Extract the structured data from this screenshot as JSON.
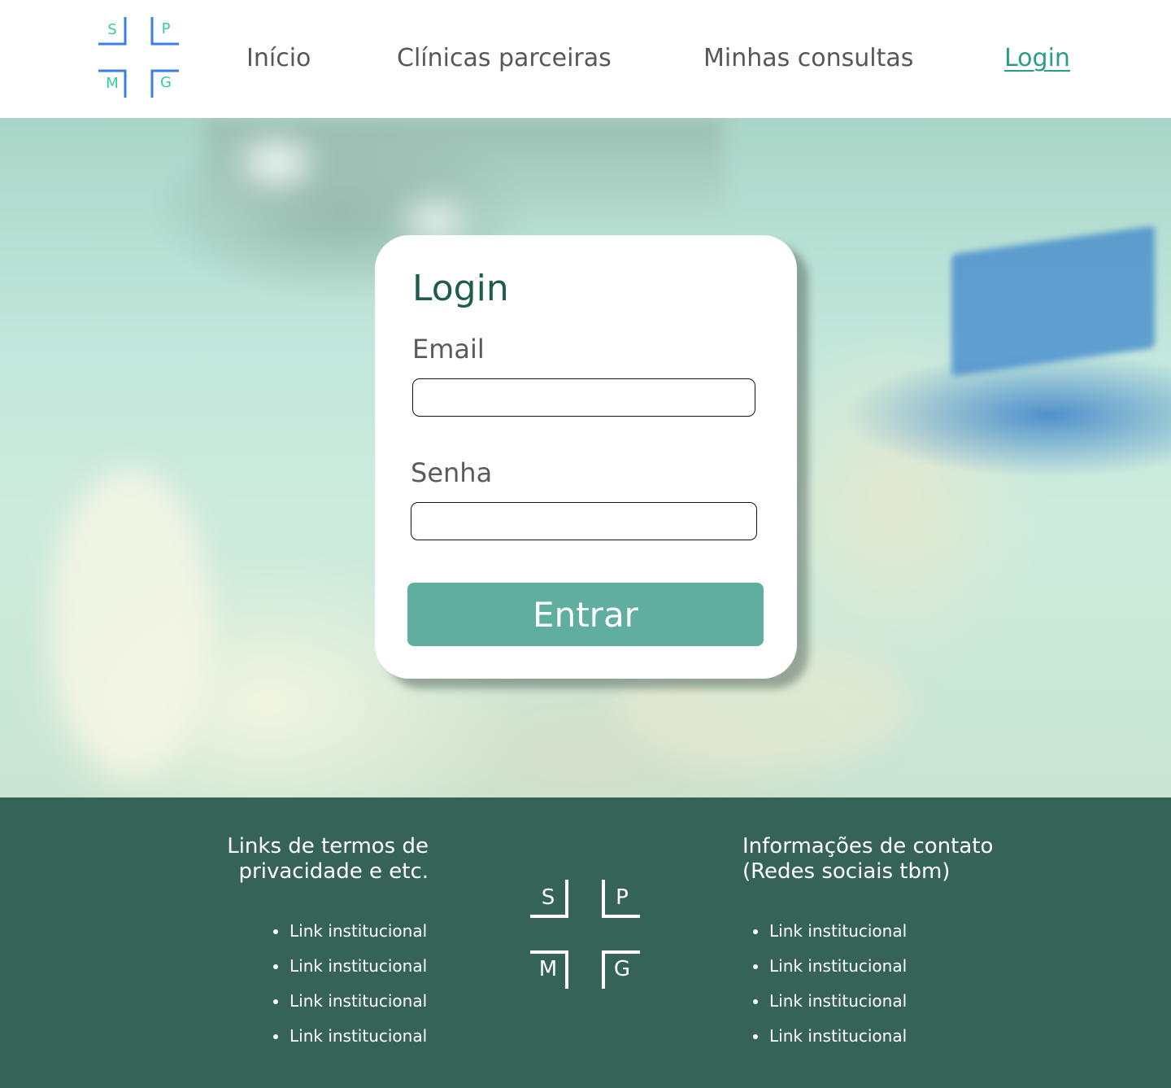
{
  "logo": {
    "letters": [
      "S",
      "P",
      "M",
      "G"
    ],
    "accent_color": "#3b7fe0",
    "letter_color": "#2fcf9f"
  },
  "nav": {
    "items": [
      {
        "label": "Início"
      },
      {
        "label": "Clínicas parceiras"
      },
      {
        "label": "Minhas consultas"
      },
      {
        "label": "Login",
        "active": true
      }
    ],
    "active_color": "#2a9d86"
  },
  "login": {
    "title": "Login",
    "email_label": "Email",
    "email_value": "",
    "password_label": "Senha",
    "password_value": "",
    "submit_label": "Entrar",
    "button_color": "#5fae9f"
  },
  "footer": {
    "background": "#356358",
    "left_heading": "Links de termos de privacidade e etc.",
    "left_links": [
      "Link institucional",
      "Link institucional",
      "Link institucional",
      "Link institucional"
    ],
    "right_heading": "Informações de contato (Redes sociais tbm)",
    "right_links": [
      "Link institucional",
      "Link institucional",
      "Link institucional",
      "Link institucional"
    ],
    "logo_letters": [
      "S",
      "P",
      "M",
      "G"
    ]
  }
}
